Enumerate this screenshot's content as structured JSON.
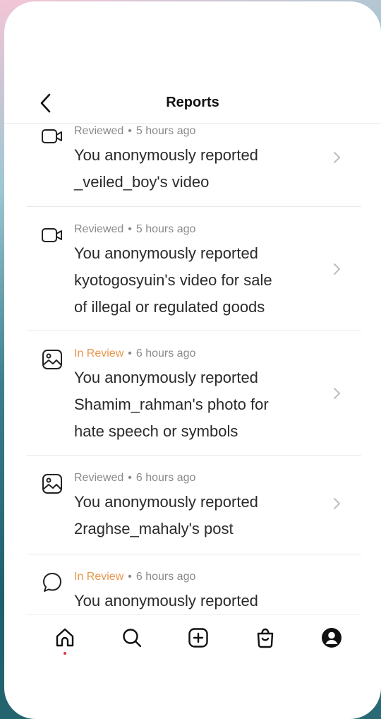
{
  "header": {
    "title": "Reports"
  },
  "colors": {
    "in_review": "#e8954a",
    "reviewed": "#8a8a8a",
    "notification_dot": "#e4323f"
  },
  "reports": [
    {
      "icon": "video-icon",
      "status": "Reviewed",
      "separator": "•",
      "time": "5 hours ago",
      "lines": [
        "You anonymously reported",
        "_veiled_boy's video"
      ]
    },
    {
      "icon": "video-icon",
      "status": "Reviewed",
      "separator": "•",
      "time": "5 hours ago",
      "lines": [
        "You anonymously reported",
        "kyotogosyuin's video for sale",
        "of illegal or regulated goods"
      ]
    },
    {
      "icon": "photo-icon",
      "status": "In Review",
      "separator": "•",
      "time": "6 hours ago",
      "lines": [
        "You anonymously reported",
        "Shamim_rahman's photo for",
        "hate speech or symbols"
      ]
    },
    {
      "icon": "photo-icon",
      "status": "Reviewed",
      "separator": "•",
      "time": "6 hours ago",
      "lines": [
        "You anonymously reported",
        "2raghse_mahaly's post"
      ]
    },
    {
      "icon": "comment-icon",
      "status": "In Review",
      "separator": "•",
      "time": "6 hours ago",
      "lines": [
        "You anonymously reported"
      ]
    }
  ],
  "nav": [
    "home-icon",
    "search-icon",
    "create-icon",
    "shop-icon",
    "profile-icon"
  ]
}
